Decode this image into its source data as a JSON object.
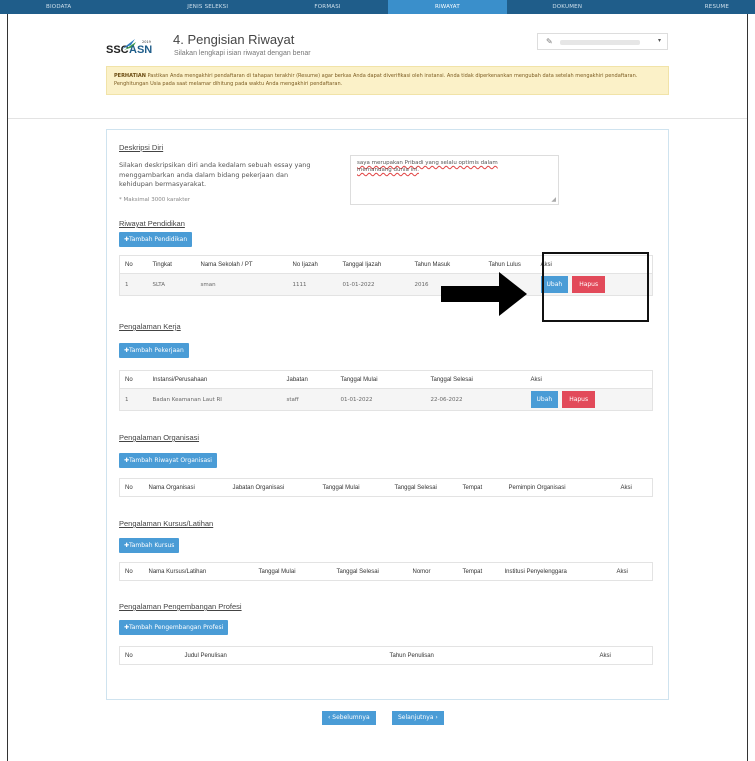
{
  "steps": [
    "BIODATA",
    "JENIS SELEKSI",
    "FORMASI",
    "RIWAYAT",
    "DOKUMEN",
    "RESUME"
  ],
  "header": {
    "logo_left": "SSC",
    "logo_right": "ASN",
    "logo_year": "2019",
    "title": "4. Pengisian Riwayat",
    "subtitle": "Silakan lengkapi isian riwayat dengan benar"
  },
  "notice": {
    "label": "PERHATIAN",
    "text": "Pastikan Anda mengakhiri pendaftaran di tahapan terakhir (Resume) agar berkas Anda dapat diverifikasi oleh instansi. Anda tidak diperkenankan mengubah data setelah mengakhiri pendaftaran. Penghitungan Usia pada saat melamar dihitung pada waktu Anda mengakhiri pendaftaran."
  },
  "deskripsi": {
    "title": "Deskripsi Diri",
    "instruction": "Silakan deskripsikan diri anda kedalam sebuah essay yang menggambarkan anda dalam bidang pekerjaan dan kehidupan bermasyarakat.",
    "note": "* Maksimal 3000 karakter",
    "value_line1": "saya merupakan Pribadi yang selalu optimis dalam",
    "value_line2": "memandang dunia ini."
  },
  "pendidikan": {
    "title": "Riwayat Pendidikan",
    "add_label": "Tambah Pendidikan",
    "columns": [
      "No",
      "Tingkat",
      "Nama Sekolah / PT",
      "No Ijazah",
      "Tanggal Ijazah",
      "Tahun Masuk",
      "Tahun Lulus",
      "Aksi"
    ],
    "rows": [
      [
        "1",
        "SLTA",
        "sman",
        "1111",
        "01-01-2022",
        "2016",
        "",
        ""
      ]
    ]
  },
  "kerja": {
    "title": "Pengalaman Kerja",
    "add_label": "Tambah Pekerjaan",
    "columns": [
      "No",
      "Instansi/Perusahaan",
      "Jabatan",
      "Tanggal Mulai",
      "Tanggal Selesai",
      "Aksi"
    ],
    "rows": [
      [
        "1",
        "Badan Keamanan Laut RI",
        "staff",
        "01-01-2022",
        "22-06-2022"
      ]
    ]
  },
  "organisasi": {
    "title": "Pengalaman Organisasi",
    "add_label": "Tambah Riwayat Organisasi",
    "columns": [
      "No",
      "Nama Organisasi",
      "Jabatan Organisasi",
      "Tanggal Mulai",
      "Tanggal Selesai",
      "Tempat",
      "Pemimpin Organisasi",
      "Aksi"
    ]
  },
  "kursus": {
    "title": "Pengalaman Kursus/Latihan",
    "add_label": "Tambah Kursus",
    "columns": [
      "No",
      "Nama Kursus/Latihan",
      "Tanggal Mulai",
      "Tanggal Selesai",
      "Nomor",
      "Tempat",
      "Institusi Penyelenggara",
      "Aksi"
    ]
  },
  "profesi": {
    "title": "Pengalaman Pengembangan Profesi",
    "add_label": "Tambah Pengembangan Profesi",
    "columns": [
      "No",
      "Judul Penulisan",
      "Tahun Penulisan",
      "Aksi"
    ]
  },
  "actions": {
    "ubah": "Ubah",
    "hapus": "Hapus"
  },
  "nav": {
    "prev": "‹ Sebelumnya",
    "next": "Selanjutnya ›"
  },
  "colors": {
    "accent": "#4a9cd6",
    "danger": "#e24a5a",
    "bar": "#1f5d8a",
    "notice_bg": "#fbf1c8"
  }
}
